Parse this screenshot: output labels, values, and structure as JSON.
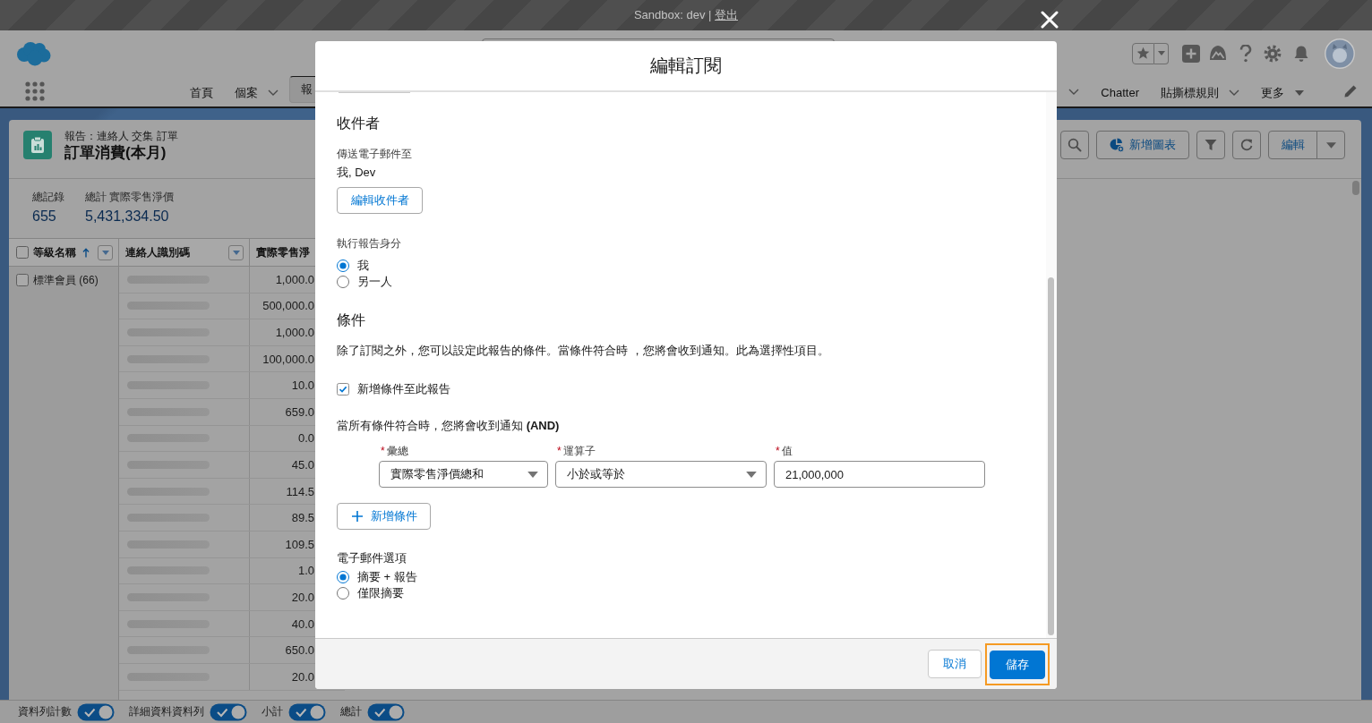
{
  "sandbox_bar": {
    "text": "Sandbox: dev |",
    "link": "登出"
  },
  "nav": {
    "left_items": [
      {
        "kind": "tab",
        "label": "首頁",
        "selected": false
      },
      {
        "kind": "menu",
        "label": "個案",
        "selected": false
      },
      {
        "kind": "tab",
        "label": "報",
        "selected": true
      }
    ],
    "right_items": [
      {
        "kind": "chevron",
        "selected": false
      },
      {
        "kind": "tab",
        "label": "Chatter",
        "selected": false
      },
      {
        "kind": "menu",
        "label": "貼撕標規則",
        "selected": false
      },
      {
        "kind": "more",
        "label": "更多",
        "selected": false
      }
    ]
  },
  "report": {
    "breadcrumb": "報告：連絡人 交集 訂單",
    "title": "訂單消費(本月)",
    "actions": [
      {
        "kind": "search"
      },
      {
        "kind": "chart",
        "label": "新增圖表"
      },
      {
        "kind": "filter"
      },
      {
        "kind": "refresh"
      },
      {
        "kind": "edit_split",
        "label": "編輯"
      }
    ],
    "summary": [
      {
        "label": "總記錄",
        "value": "655"
      },
      {
        "label": "總計 實際零售淨價",
        "value": "5,431,334.50"
      }
    ],
    "table": {
      "columns": [
        {
          "label": "等級名稱",
          "checked": false,
          "sorted_ascending": true,
          "menu": true
        },
        {
          "label": "連絡人識別碼",
          "sorted_ascending": false,
          "menu": true
        },
        {
          "label": "實際零售淨",
          "sorted_ascending": false,
          "menu": false
        }
      ],
      "group": {
        "label": "標準會員 (66)",
        "checked": false
      },
      "rows": [
        {
          "amount": "1,000.0"
        },
        {
          "amount": "500,000.0"
        },
        {
          "amount": "1,000.0"
        },
        {
          "amount": "100,000.0"
        },
        {
          "amount": "10.0"
        },
        {
          "amount": "659.0"
        },
        {
          "amount": "0.0"
        },
        {
          "amount": "45.0"
        },
        {
          "amount": "114.5"
        },
        {
          "amount": "89.5"
        },
        {
          "amount": "109.5"
        },
        {
          "amount": "1.0"
        },
        {
          "amount": "20.0"
        },
        {
          "amount": "40.0"
        },
        {
          "amount": "650.0"
        },
        {
          "amount": "20.0"
        }
      ]
    }
  },
  "footer": {
    "toggles": [
      {
        "label": "資料列計數",
        "on": true
      },
      {
        "label": "詳細資料資料列",
        "on": true
      },
      {
        "label": "小計",
        "on": true
      },
      {
        "label": "總計",
        "on": true
      }
    ]
  },
  "modal": {
    "title": "編輯訂閱",
    "recipients": {
      "heading": "收件者",
      "send_to_label": "傳送電子郵件至",
      "send_to_value": "我, Dev",
      "edit_button": "編輯收件者"
    },
    "run_as": {
      "label": "執行報告身分",
      "options": [
        {
          "label": "我",
          "selected": true
        },
        {
          "label": "另一人",
          "selected": false
        }
      ]
    },
    "conditions": {
      "heading": "條件",
      "description": "除了訂閱之外，您可以設定此報告的條件。當條件符合時 ，您將會收到通知。此為選擇性項目。",
      "enable": {
        "label": "新增條件至此報告",
        "checked": true
      },
      "match_text": "當所有條件符合時，您將會收到通知 **(AND)**",
      "fields": [
        {
          "kind": "select",
          "required_mark": "*",
          "label": "彙總",
          "value": "實際零售淨價總和"
        },
        {
          "kind": "select",
          "required_mark": "*",
          "label": "運算子",
          "value": "小於或等於"
        },
        {
          "kind": "input",
          "required_mark": "*",
          "label": "值",
          "value": "21,000,000"
        }
      ],
      "add_button": "新增條件"
    },
    "email_options": {
      "label": "電子郵件選項",
      "options": [
        {
          "label": "摘要 + 報告",
          "selected": true
        },
        {
          "label": "僅限摘要",
          "selected": false
        }
      ]
    },
    "buttons": [
      {
        "kind": "neutral",
        "label": "取消",
        "highlighted": false
      },
      {
        "kind": "brand",
        "label": "儲存",
        "highlighted": true
      }
    ]
  }
}
